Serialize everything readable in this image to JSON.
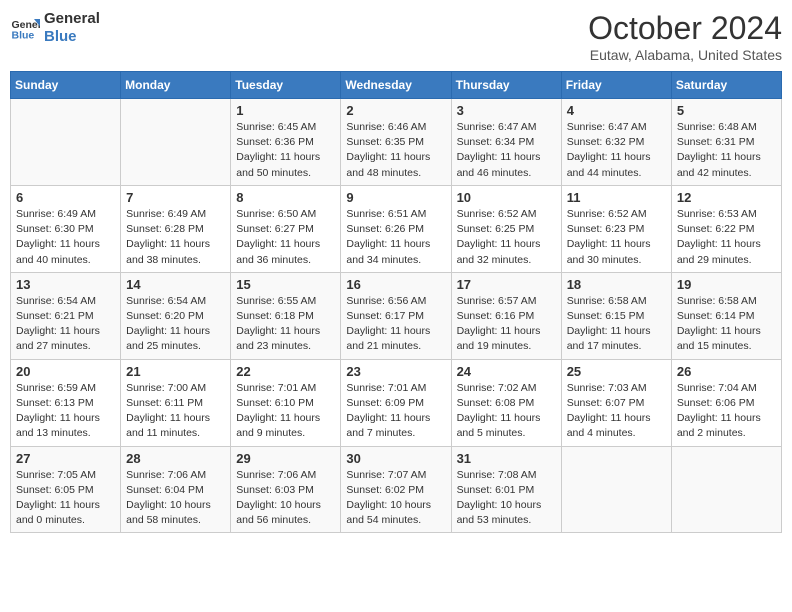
{
  "header": {
    "logo_line1": "General",
    "logo_line2": "Blue",
    "month": "October 2024",
    "location": "Eutaw, Alabama, United States"
  },
  "days_of_week": [
    "Sunday",
    "Monday",
    "Tuesday",
    "Wednesday",
    "Thursday",
    "Friday",
    "Saturday"
  ],
  "weeks": [
    [
      {
        "day": "",
        "info": ""
      },
      {
        "day": "",
        "info": ""
      },
      {
        "day": "1",
        "info": "Sunrise: 6:45 AM\nSunset: 6:36 PM\nDaylight: 11 hours and 50 minutes."
      },
      {
        "day": "2",
        "info": "Sunrise: 6:46 AM\nSunset: 6:35 PM\nDaylight: 11 hours and 48 minutes."
      },
      {
        "day": "3",
        "info": "Sunrise: 6:47 AM\nSunset: 6:34 PM\nDaylight: 11 hours and 46 minutes."
      },
      {
        "day": "4",
        "info": "Sunrise: 6:47 AM\nSunset: 6:32 PM\nDaylight: 11 hours and 44 minutes."
      },
      {
        "day": "5",
        "info": "Sunrise: 6:48 AM\nSunset: 6:31 PM\nDaylight: 11 hours and 42 minutes."
      }
    ],
    [
      {
        "day": "6",
        "info": "Sunrise: 6:49 AM\nSunset: 6:30 PM\nDaylight: 11 hours and 40 minutes."
      },
      {
        "day": "7",
        "info": "Sunrise: 6:49 AM\nSunset: 6:28 PM\nDaylight: 11 hours and 38 minutes."
      },
      {
        "day": "8",
        "info": "Sunrise: 6:50 AM\nSunset: 6:27 PM\nDaylight: 11 hours and 36 minutes."
      },
      {
        "day": "9",
        "info": "Sunrise: 6:51 AM\nSunset: 6:26 PM\nDaylight: 11 hours and 34 minutes."
      },
      {
        "day": "10",
        "info": "Sunrise: 6:52 AM\nSunset: 6:25 PM\nDaylight: 11 hours and 32 minutes."
      },
      {
        "day": "11",
        "info": "Sunrise: 6:52 AM\nSunset: 6:23 PM\nDaylight: 11 hours and 30 minutes."
      },
      {
        "day": "12",
        "info": "Sunrise: 6:53 AM\nSunset: 6:22 PM\nDaylight: 11 hours and 29 minutes."
      }
    ],
    [
      {
        "day": "13",
        "info": "Sunrise: 6:54 AM\nSunset: 6:21 PM\nDaylight: 11 hours and 27 minutes."
      },
      {
        "day": "14",
        "info": "Sunrise: 6:54 AM\nSunset: 6:20 PM\nDaylight: 11 hours and 25 minutes."
      },
      {
        "day": "15",
        "info": "Sunrise: 6:55 AM\nSunset: 6:18 PM\nDaylight: 11 hours and 23 minutes."
      },
      {
        "day": "16",
        "info": "Sunrise: 6:56 AM\nSunset: 6:17 PM\nDaylight: 11 hours and 21 minutes."
      },
      {
        "day": "17",
        "info": "Sunrise: 6:57 AM\nSunset: 6:16 PM\nDaylight: 11 hours and 19 minutes."
      },
      {
        "day": "18",
        "info": "Sunrise: 6:58 AM\nSunset: 6:15 PM\nDaylight: 11 hours and 17 minutes."
      },
      {
        "day": "19",
        "info": "Sunrise: 6:58 AM\nSunset: 6:14 PM\nDaylight: 11 hours and 15 minutes."
      }
    ],
    [
      {
        "day": "20",
        "info": "Sunrise: 6:59 AM\nSunset: 6:13 PM\nDaylight: 11 hours and 13 minutes."
      },
      {
        "day": "21",
        "info": "Sunrise: 7:00 AM\nSunset: 6:11 PM\nDaylight: 11 hours and 11 minutes."
      },
      {
        "day": "22",
        "info": "Sunrise: 7:01 AM\nSunset: 6:10 PM\nDaylight: 11 hours and 9 minutes."
      },
      {
        "day": "23",
        "info": "Sunrise: 7:01 AM\nSunset: 6:09 PM\nDaylight: 11 hours and 7 minutes."
      },
      {
        "day": "24",
        "info": "Sunrise: 7:02 AM\nSunset: 6:08 PM\nDaylight: 11 hours and 5 minutes."
      },
      {
        "day": "25",
        "info": "Sunrise: 7:03 AM\nSunset: 6:07 PM\nDaylight: 11 hours and 4 minutes."
      },
      {
        "day": "26",
        "info": "Sunrise: 7:04 AM\nSunset: 6:06 PM\nDaylight: 11 hours and 2 minutes."
      }
    ],
    [
      {
        "day": "27",
        "info": "Sunrise: 7:05 AM\nSunset: 6:05 PM\nDaylight: 11 hours and 0 minutes."
      },
      {
        "day": "28",
        "info": "Sunrise: 7:06 AM\nSunset: 6:04 PM\nDaylight: 10 hours and 58 minutes."
      },
      {
        "day": "29",
        "info": "Sunrise: 7:06 AM\nSunset: 6:03 PM\nDaylight: 10 hours and 56 minutes."
      },
      {
        "day": "30",
        "info": "Sunrise: 7:07 AM\nSunset: 6:02 PM\nDaylight: 10 hours and 54 minutes."
      },
      {
        "day": "31",
        "info": "Sunrise: 7:08 AM\nSunset: 6:01 PM\nDaylight: 10 hours and 53 minutes."
      },
      {
        "day": "",
        "info": ""
      },
      {
        "day": "",
        "info": ""
      }
    ]
  ]
}
